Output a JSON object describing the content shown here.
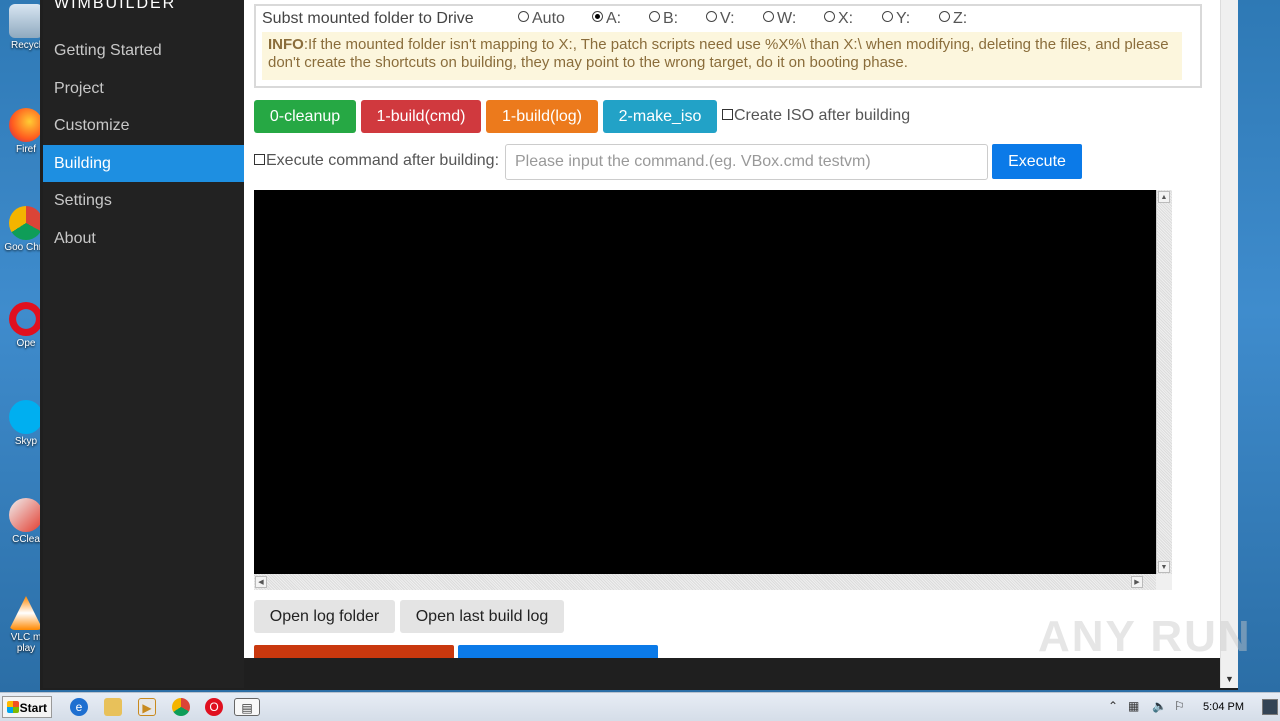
{
  "app": {
    "brand": "WIMBUILDER"
  },
  "desktop": {
    "icons": [
      {
        "label": "Recycl",
        "name": "recycle-bin"
      },
      {
        "label": "Firef",
        "name": "firefox"
      },
      {
        "label": "Goo Chro",
        "name": "chrome"
      },
      {
        "label": "Ope",
        "name": "opera"
      },
      {
        "label": "Skyp",
        "name": "skype"
      },
      {
        "label": "CClea",
        "name": "ccleaner"
      },
      {
        "label": "VLC m play",
        "name": "vlc"
      }
    ]
  },
  "sidebar": {
    "items": [
      {
        "label": "Getting Started"
      },
      {
        "label": "Project"
      },
      {
        "label": "Customize"
      },
      {
        "label": "Building"
      },
      {
        "label": "Settings"
      },
      {
        "label": "About"
      }
    ],
    "active_index": 3
  },
  "subst": {
    "label": "Subst mounted folder to Drive",
    "options": [
      "Auto",
      "A:",
      "B:",
      "V:",
      "W:",
      "X:",
      "Y:",
      "Z:"
    ],
    "selected": "A:",
    "info_title": "INFO",
    "info_text": ":If the mounted folder isn't mapping to X:, The patch scripts need use %X%\\ than X:\\ when modifying, deleting the files, and please don't create the shortcuts on building, they may point to the wrong target, do it on booting phase."
  },
  "actions": {
    "cleanup": "0-cleanup",
    "build_cmd": "1-build(cmd)",
    "build_log": "1-build(log)",
    "make_iso": "2-make_iso",
    "create_iso_label": "Create ISO after building",
    "create_iso_checked": false
  },
  "command": {
    "exec_after_label": "Execute command after building:",
    "exec_after_checked": false,
    "placeholder": "Please input the command.(eg. VBox.cmd testvm)",
    "value": "",
    "execute_label": "Execute"
  },
  "log": {
    "open_folder": "Open log folder",
    "open_last": "Open last build log"
  },
  "watermark": "ANY RUN",
  "taskbar": {
    "start_label": "Start",
    "clock": "5:04 PM"
  },
  "colors": {
    "accent": "#1e8fe1",
    "green": "#26a844",
    "red": "#d0393e",
    "orange": "#ec7a1c",
    "cyan": "#22a2c7",
    "blue": "#0b7ae8"
  }
}
